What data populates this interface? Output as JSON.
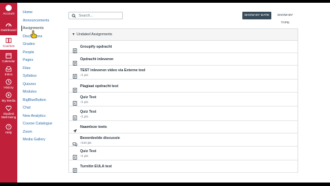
{
  "global_nav": [
    {
      "label": "Account",
      "icon": "account-avatar"
    },
    {
      "label": "Dashboard",
      "icon": "dashboard-icon"
    },
    {
      "label": "Courses",
      "icon": "courses-icon",
      "active": true
    },
    {
      "label": "Calendar",
      "icon": "calendar-icon"
    },
    {
      "label": "Inbox",
      "icon": "inbox-icon"
    },
    {
      "label": "History",
      "icon": "history-icon"
    },
    {
      "label": "My Media",
      "icon": "media-icon"
    },
    {
      "label": "Student Well-being",
      "icon": "wellbeing-icon"
    },
    {
      "label": "Help",
      "icon": "help-icon"
    }
  ],
  "course_nav": [
    {
      "label": "Home"
    },
    {
      "label": "Announcements"
    },
    {
      "label": "Assignments",
      "active": true
    },
    {
      "label": "Discussions"
    },
    {
      "label": "Grades"
    },
    {
      "label": "People"
    },
    {
      "label": "Pages"
    },
    {
      "label": "Files"
    },
    {
      "label": "Syllabus"
    },
    {
      "label": "Quizzes"
    },
    {
      "label": "Modules"
    },
    {
      "label": "BigBlueButton"
    },
    {
      "label": "Chat"
    },
    {
      "label": "New Analytics"
    },
    {
      "label": "Course Catalogue"
    },
    {
      "label": "Zoom"
    },
    {
      "label": "Media Gallery"
    }
  ],
  "search": {
    "placeholder": "Search..."
  },
  "toolbar": {
    "show_by_date": "SHOW BY DATE",
    "show_by_type": "SHOW BY TYPE"
  },
  "group": {
    "title": "Undated Assignments"
  },
  "assignments": [
    {
      "name": "Groupify opdracht",
      "meta": "",
      "icon": "assignment-icon"
    },
    {
      "name": "Opdracht inleveren",
      "meta": "",
      "icon": "assignment-icon"
    },
    {
      "name": "TEST inleveren video via Externe tool",
      "meta": "-/1 pts",
      "icon": "assignment-icon"
    },
    {
      "name": "Plagiaat opdracht test",
      "meta": "",
      "icon": "assignment-icon"
    },
    {
      "name": "Quiz Test",
      "meta": "-/1 pts",
      "icon": "quiz-icon"
    },
    {
      "name": "Quiz Test",
      "meta": "-/1 pts",
      "icon": "quiz-icon"
    },
    {
      "name": "Naamloze toets",
      "meta": "",
      "icon": "rocket-icon"
    },
    {
      "name": "Beoordeelde discussie",
      "meta": "-/100 pts",
      "icon": "discussion-icon"
    },
    {
      "name": "Quiz Test",
      "meta": "-/1 pts",
      "icon": "quiz-icon"
    },
    {
      "name": "Turnitin EULA test",
      "meta": "",
      "icon": "assignment-icon"
    }
  ],
  "colors": {
    "brand": "#c0203a",
    "link": "#2d6dab",
    "text": "#2d3b45",
    "button_dark": "#394b58"
  }
}
